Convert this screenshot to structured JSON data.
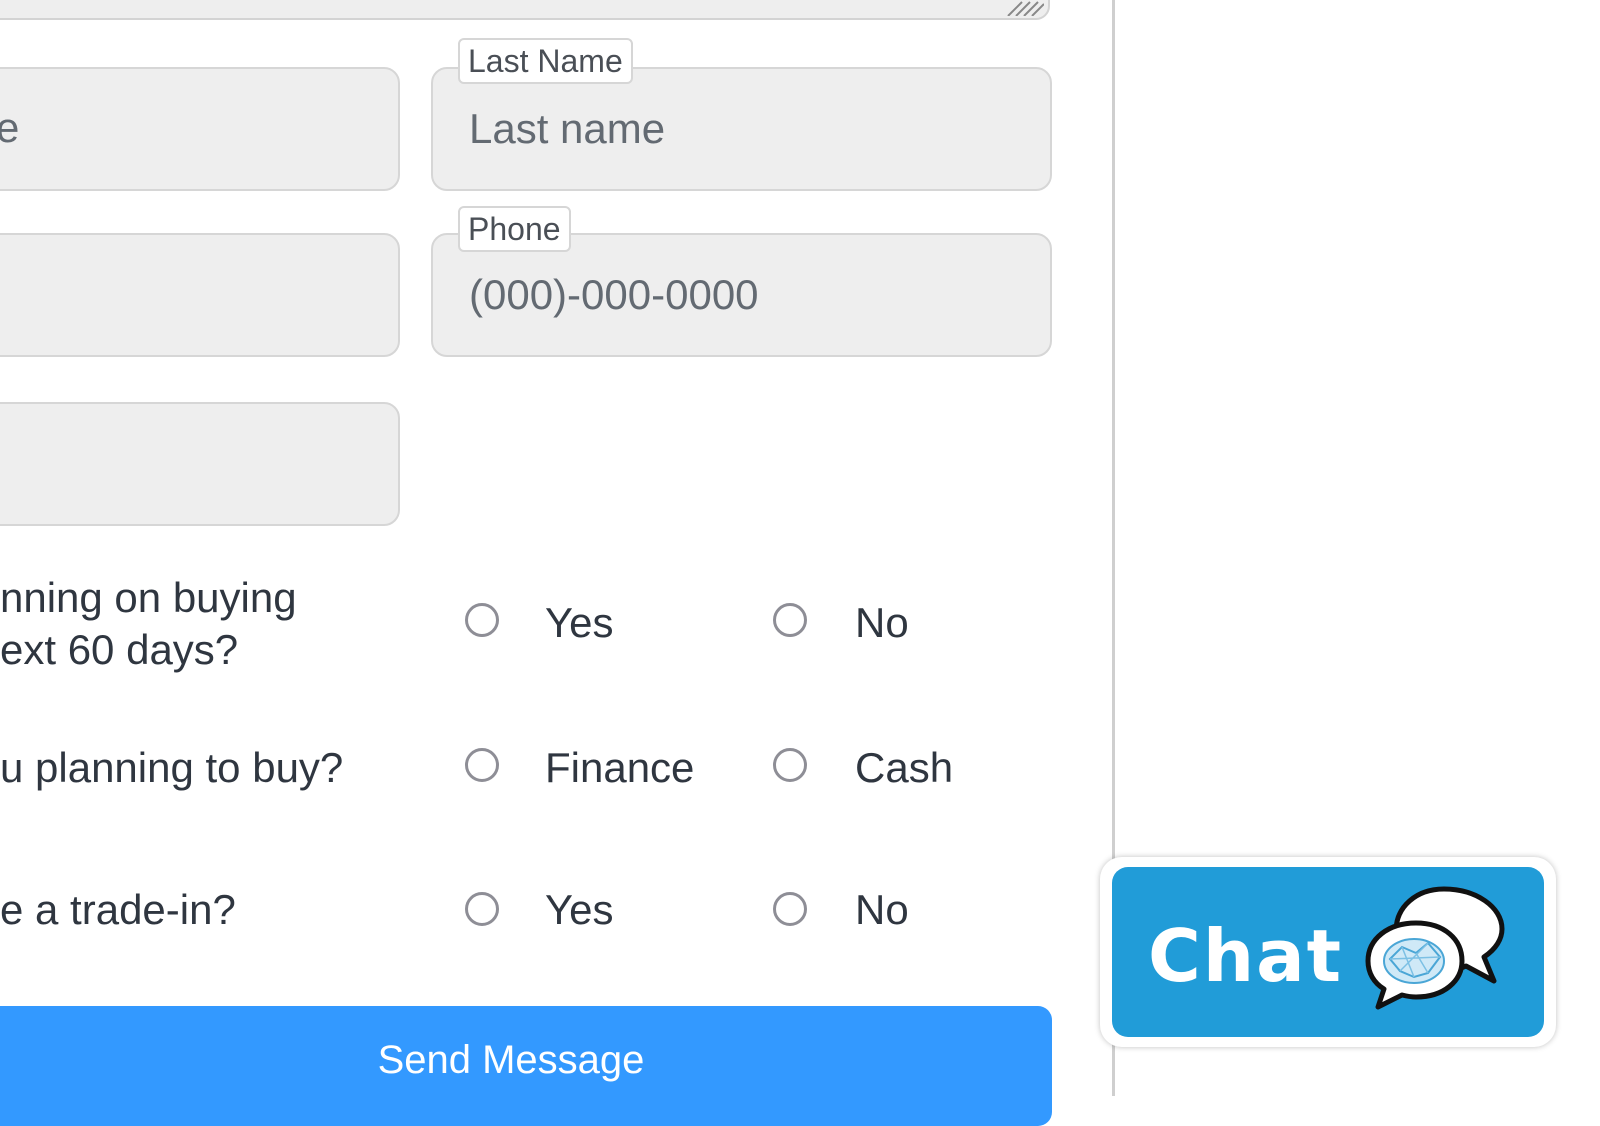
{
  "form": {
    "first_name": {
      "placeholder": "First name",
      "visible_fragment": "e"
    },
    "last_name": {
      "label": "Last Name",
      "placeholder": "Last name"
    },
    "phone": {
      "label": "Phone",
      "placeholder": "(000)-000-0000"
    },
    "questions": [
      {
        "text_line1": "nning on buying",
        "text_line2": "ext 60 days?",
        "options": [
          "Yes",
          "No"
        ]
      },
      {
        "text_line1": "u planning to buy?",
        "options": [
          "Finance",
          "Cash"
        ]
      },
      {
        "text_line1": "e a trade-in?",
        "options": [
          "Yes",
          "No"
        ]
      }
    ],
    "submit_label": "Send Message"
  },
  "chat": {
    "label": "Chat",
    "icon": "chat-bubbles-brain-icon",
    "color": "#219cd8"
  },
  "colors": {
    "field_bg": "#eeeeee",
    "button": "#3399ff"
  }
}
